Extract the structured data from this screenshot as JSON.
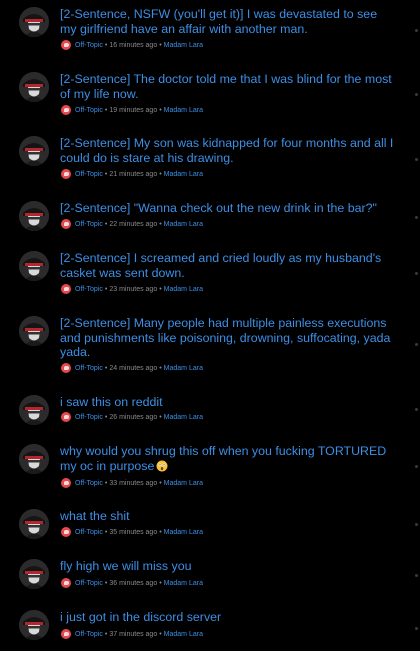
{
  "feed": {
    "accent_color": "#3d8fe6",
    "category_color": "#e5484d",
    "items": [
      {
        "title": "[2-Sentence, NSFW (you'll get it)] I was devastated to see my girlfriend have an affair with another man.",
        "category": "Off-Topic",
        "time": "16 minutes ago",
        "author": "Madam Lara"
      },
      {
        "title": "[2-Sentence] The doctor told me that I was blind for the most of my life now.",
        "category": "Off-Topic",
        "time": "19 minutes ago",
        "author": "Madam Lara"
      },
      {
        "title": "[2-Sentence] My son was kidnapped for four months and all I could do is stare at his drawing.",
        "category": "Off-Topic",
        "time": "21 minutes ago",
        "author": "Madam Lara"
      },
      {
        "title": "[2-Sentence] \"Wanna check out the new drink in the bar?\"",
        "category": "Off-Topic",
        "time": "22 minutes ago",
        "author": "Madam Lara"
      },
      {
        "title": "[2-Sentence] I screamed and cried loudly as my husband's casket was sent down.",
        "category": "Off-Topic",
        "time": "23 minutes ago",
        "author": "Madam Lara"
      },
      {
        "title": "[2-Sentence] Many people had multiple painless executions and punishments like poisoning, drowning, suffocating, yada yada.",
        "category": "Off-Topic",
        "time": "24 minutes ago",
        "author": "Madam Lara"
      },
      {
        "title": "i saw this on reddit",
        "category": "Off-Topic",
        "time": "26 minutes ago",
        "author": "Madam Lara"
      },
      {
        "title": "why would you shrug this off when you fucking TORTURED my oc in purpose",
        "category": "Off-Topic",
        "time": "33 minutes ago",
        "author": "Madam Lara",
        "emoji": "astonished-face-emoji"
      },
      {
        "title": "what the shit",
        "category": "Off-Topic",
        "time": "35 minutes ago",
        "author": "Madam Lara"
      },
      {
        "title": "fly high we will miss you",
        "category": "Off-Topic",
        "time": "36 minutes ago",
        "author": "Madam Lara"
      },
      {
        "title": "i just got in the discord server",
        "category": "Off-Topic",
        "time": "37 minutes ago",
        "author": "Madam Lara"
      }
    ]
  }
}
